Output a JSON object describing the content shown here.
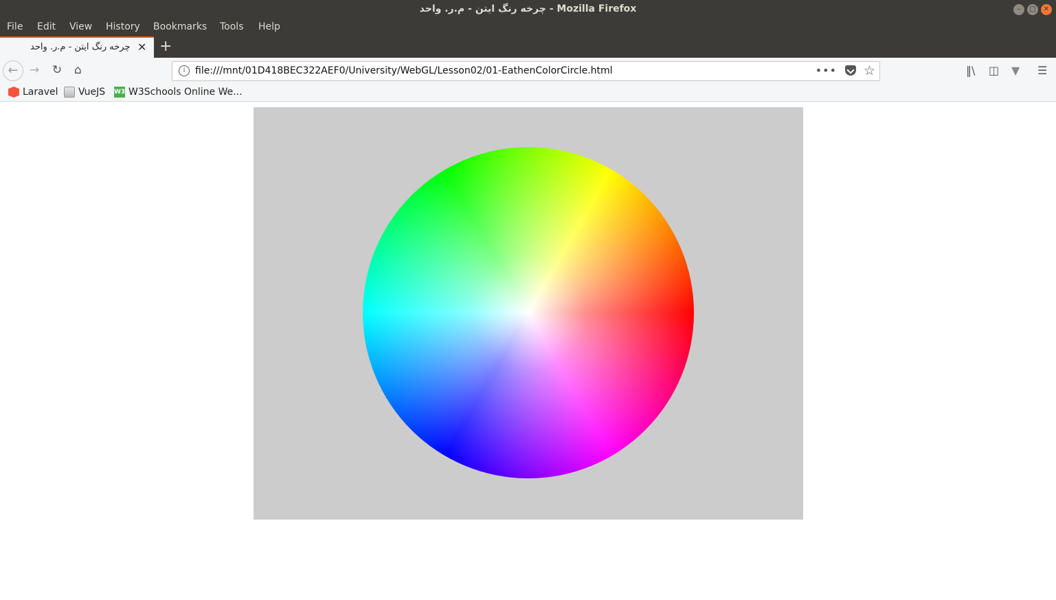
{
  "window": {
    "title": "چرخه رنگ ایتن - م.ر. واحد - Mozilla Firefox"
  },
  "menu": [
    "File",
    "Edit",
    "View",
    "History",
    "Bookmarks",
    "Tools",
    "Help"
  ],
  "tab": {
    "title": "چرخه رنگ ایتن - م.ر. واحد",
    "close": "✕"
  },
  "new_tab": "+",
  "nav": {
    "url": "file:///mnt/01D418BEC322AEF0/University/WebGL/Lesson02/01-EathenColorCircle.html",
    "more": "•••"
  },
  "bookmarks": [
    {
      "label": "Laravel",
      "icon": "laravel-icon"
    },
    {
      "label": "VueJS",
      "icon": "vue-icon"
    },
    {
      "label": "W3Schools Online We...",
      "icon": "w3schools-icon"
    }
  ],
  "colors": {
    "canvas_bg": "#cccccc",
    "tab_accent": "#e66124",
    "titlebar": "#3c3b37"
  }
}
